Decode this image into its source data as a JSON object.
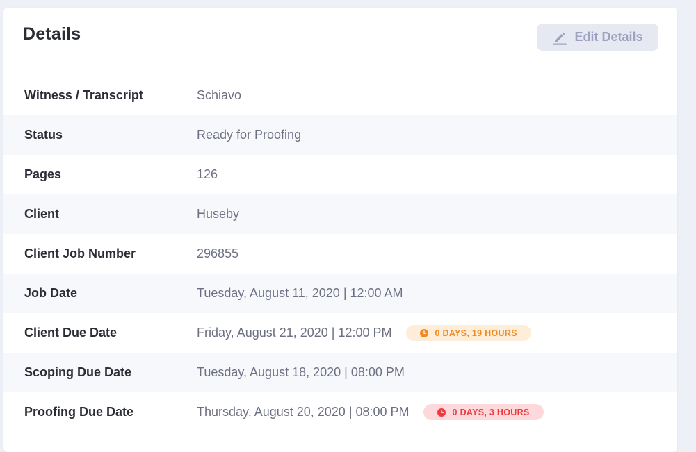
{
  "header": {
    "title": "Details",
    "edit_button_label": "Edit Details"
  },
  "details": [
    {
      "label": "Witness / Transcript",
      "value": "Schiavo"
    },
    {
      "label": "Status",
      "value": "Ready for Proofing"
    },
    {
      "label": "Pages",
      "value": "126"
    },
    {
      "label": "Client",
      "value": "Huseby"
    },
    {
      "label": "Client Job Number",
      "value": "296855"
    },
    {
      "label": "Job Date",
      "value": "Tuesday, August 11, 2020 | 12:00 AM"
    },
    {
      "label": "Client Due Date",
      "value": "Friday, August 21, 2020 | 12:00 PM",
      "badge": "0 DAYS, 19 HOURS"
    },
    {
      "label": "Scoping Due Date",
      "value": "Tuesday, August 18, 2020 | 08:00 PM"
    },
    {
      "label": "Proofing Due Date",
      "value": "Thursday, August 20, 2020 | 08:00 PM",
      "badge": "0 DAYS, 3 HOURS"
    }
  ],
  "colors": {
    "warning_badge_text": "#f28a23",
    "warning_badge_bg": "#feeed9",
    "danger_badge_text": "#ee3a3f",
    "danger_badge_bg": "#fdd9db"
  }
}
